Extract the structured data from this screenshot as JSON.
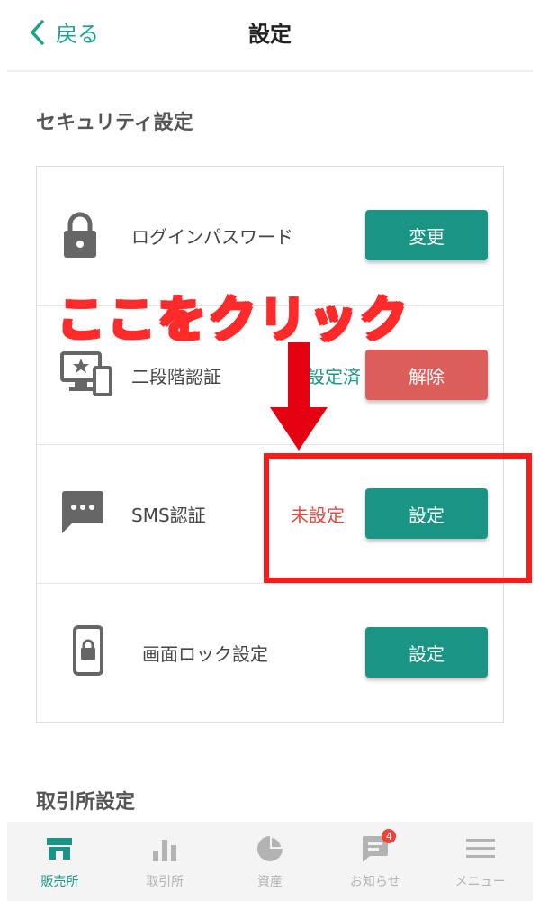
{
  "header": {
    "back_label": "戻る",
    "title": "設定"
  },
  "security": {
    "section_title": "セキュリティ設定",
    "rows": [
      {
        "label": "ログインパスワード",
        "status": "",
        "button": "変更",
        "icon": "lock-icon"
      },
      {
        "label": "二段階認証",
        "status": "設定済",
        "button": "解除",
        "icon": "two-factor-devices-icon"
      },
      {
        "label": "SMS認証",
        "status": "未設定",
        "button": "設定",
        "icon": "sms-chat-icon"
      },
      {
        "label": "画面ロック設定",
        "status": "",
        "button": "設定",
        "icon": "phone-lock-icon"
      }
    ]
  },
  "exchange": {
    "section_title": "取引所設定"
  },
  "annotation": {
    "callout": "ここをクリック"
  },
  "tabbar": {
    "items": [
      {
        "label": "販売所",
        "icon": "store-icon",
        "active": true
      },
      {
        "label": "取引所",
        "icon": "bar-chart-icon",
        "active": false
      },
      {
        "label": "資産",
        "icon": "pie-chart-icon",
        "active": false
      },
      {
        "label": "お知らせ",
        "icon": "message-icon",
        "active": false,
        "badge": "4"
      },
      {
        "label": "メニュー",
        "icon": "hamburger-icon",
        "active": false
      }
    ]
  },
  "colors": {
    "accent": "#1a9485",
    "danger": "#dc5e5a",
    "warning_text": "#e04a3f",
    "highlight": "#ff1a1a"
  }
}
